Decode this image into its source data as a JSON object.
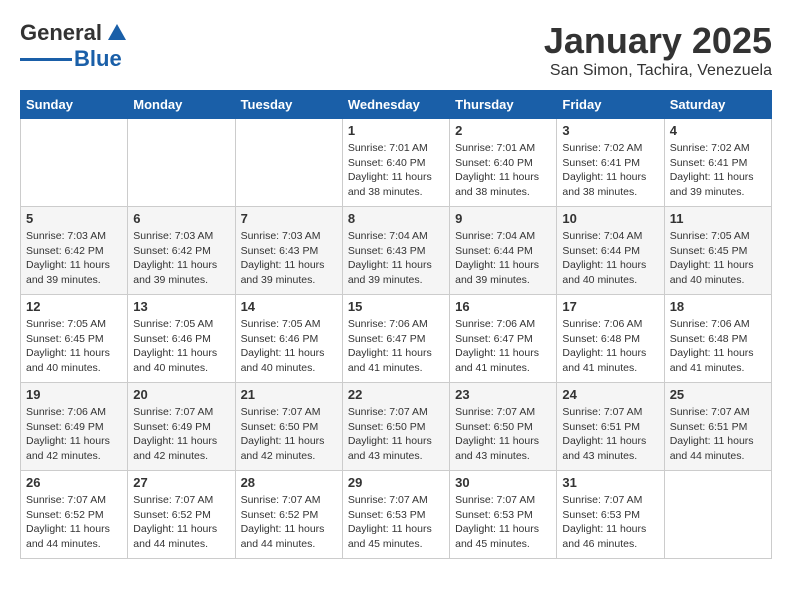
{
  "logo": {
    "general": "General",
    "blue": "Blue"
  },
  "title": "January 2025",
  "location": "San Simon, Tachira, Venezuela",
  "headers": [
    "Sunday",
    "Monday",
    "Tuesday",
    "Wednesday",
    "Thursday",
    "Friday",
    "Saturday"
  ],
  "weeks": [
    [
      {
        "day": "",
        "info": ""
      },
      {
        "day": "",
        "info": ""
      },
      {
        "day": "",
        "info": ""
      },
      {
        "day": "1",
        "info": "Sunrise: 7:01 AM\nSunset: 6:40 PM\nDaylight: 11 hours\nand 38 minutes."
      },
      {
        "day": "2",
        "info": "Sunrise: 7:01 AM\nSunset: 6:40 PM\nDaylight: 11 hours\nand 38 minutes."
      },
      {
        "day": "3",
        "info": "Sunrise: 7:02 AM\nSunset: 6:41 PM\nDaylight: 11 hours\nand 38 minutes."
      },
      {
        "day": "4",
        "info": "Sunrise: 7:02 AM\nSunset: 6:41 PM\nDaylight: 11 hours\nand 39 minutes."
      }
    ],
    [
      {
        "day": "5",
        "info": "Sunrise: 7:03 AM\nSunset: 6:42 PM\nDaylight: 11 hours\nand 39 minutes."
      },
      {
        "day": "6",
        "info": "Sunrise: 7:03 AM\nSunset: 6:42 PM\nDaylight: 11 hours\nand 39 minutes."
      },
      {
        "day": "7",
        "info": "Sunrise: 7:03 AM\nSunset: 6:43 PM\nDaylight: 11 hours\nand 39 minutes."
      },
      {
        "day": "8",
        "info": "Sunrise: 7:04 AM\nSunset: 6:43 PM\nDaylight: 11 hours\nand 39 minutes."
      },
      {
        "day": "9",
        "info": "Sunrise: 7:04 AM\nSunset: 6:44 PM\nDaylight: 11 hours\nand 39 minutes."
      },
      {
        "day": "10",
        "info": "Sunrise: 7:04 AM\nSunset: 6:44 PM\nDaylight: 11 hours\nand 40 minutes."
      },
      {
        "day": "11",
        "info": "Sunrise: 7:05 AM\nSunset: 6:45 PM\nDaylight: 11 hours\nand 40 minutes."
      }
    ],
    [
      {
        "day": "12",
        "info": "Sunrise: 7:05 AM\nSunset: 6:45 PM\nDaylight: 11 hours\nand 40 minutes."
      },
      {
        "day": "13",
        "info": "Sunrise: 7:05 AM\nSunset: 6:46 PM\nDaylight: 11 hours\nand 40 minutes."
      },
      {
        "day": "14",
        "info": "Sunrise: 7:05 AM\nSunset: 6:46 PM\nDaylight: 11 hours\nand 40 minutes."
      },
      {
        "day": "15",
        "info": "Sunrise: 7:06 AM\nSunset: 6:47 PM\nDaylight: 11 hours\nand 41 minutes."
      },
      {
        "day": "16",
        "info": "Sunrise: 7:06 AM\nSunset: 6:47 PM\nDaylight: 11 hours\nand 41 minutes."
      },
      {
        "day": "17",
        "info": "Sunrise: 7:06 AM\nSunset: 6:48 PM\nDaylight: 11 hours\nand 41 minutes."
      },
      {
        "day": "18",
        "info": "Sunrise: 7:06 AM\nSunset: 6:48 PM\nDaylight: 11 hours\nand 41 minutes."
      }
    ],
    [
      {
        "day": "19",
        "info": "Sunrise: 7:06 AM\nSunset: 6:49 PM\nDaylight: 11 hours\nand 42 minutes."
      },
      {
        "day": "20",
        "info": "Sunrise: 7:07 AM\nSunset: 6:49 PM\nDaylight: 11 hours\nand 42 minutes."
      },
      {
        "day": "21",
        "info": "Sunrise: 7:07 AM\nSunset: 6:50 PM\nDaylight: 11 hours\nand 42 minutes."
      },
      {
        "day": "22",
        "info": "Sunrise: 7:07 AM\nSunset: 6:50 PM\nDaylight: 11 hours\nand 43 minutes."
      },
      {
        "day": "23",
        "info": "Sunrise: 7:07 AM\nSunset: 6:50 PM\nDaylight: 11 hours\nand 43 minutes."
      },
      {
        "day": "24",
        "info": "Sunrise: 7:07 AM\nSunset: 6:51 PM\nDaylight: 11 hours\nand 43 minutes."
      },
      {
        "day": "25",
        "info": "Sunrise: 7:07 AM\nSunset: 6:51 PM\nDaylight: 11 hours\nand 44 minutes."
      }
    ],
    [
      {
        "day": "26",
        "info": "Sunrise: 7:07 AM\nSunset: 6:52 PM\nDaylight: 11 hours\nand 44 minutes."
      },
      {
        "day": "27",
        "info": "Sunrise: 7:07 AM\nSunset: 6:52 PM\nDaylight: 11 hours\nand 44 minutes."
      },
      {
        "day": "28",
        "info": "Sunrise: 7:07 AM\nSunset: 6:52 PM\nDaylight: 11 hours\nand 44 minutes."
      },
      {
        "day": "29",
        "info": "Sunrise: 7:07 AM\nSunset: 6:53 PM\nDaylight: 11 hours\nand 45 minutes."
      },
      {
        "day": "30",
        "info": "Sunrise: 7:07 AM\nSunset: 6:53 PM\nDaylight: 11 hours\nand 45 minutes."
      },
      {
        "day": "31",
        "info": "Sunrise: 7:07 AM\nSunset: 6:53 PM\nDaylight: 11 hours\nand 46 minutes."
      },
      {
        "day": "",
        "info": ""
      }
    ]
  ]
}
